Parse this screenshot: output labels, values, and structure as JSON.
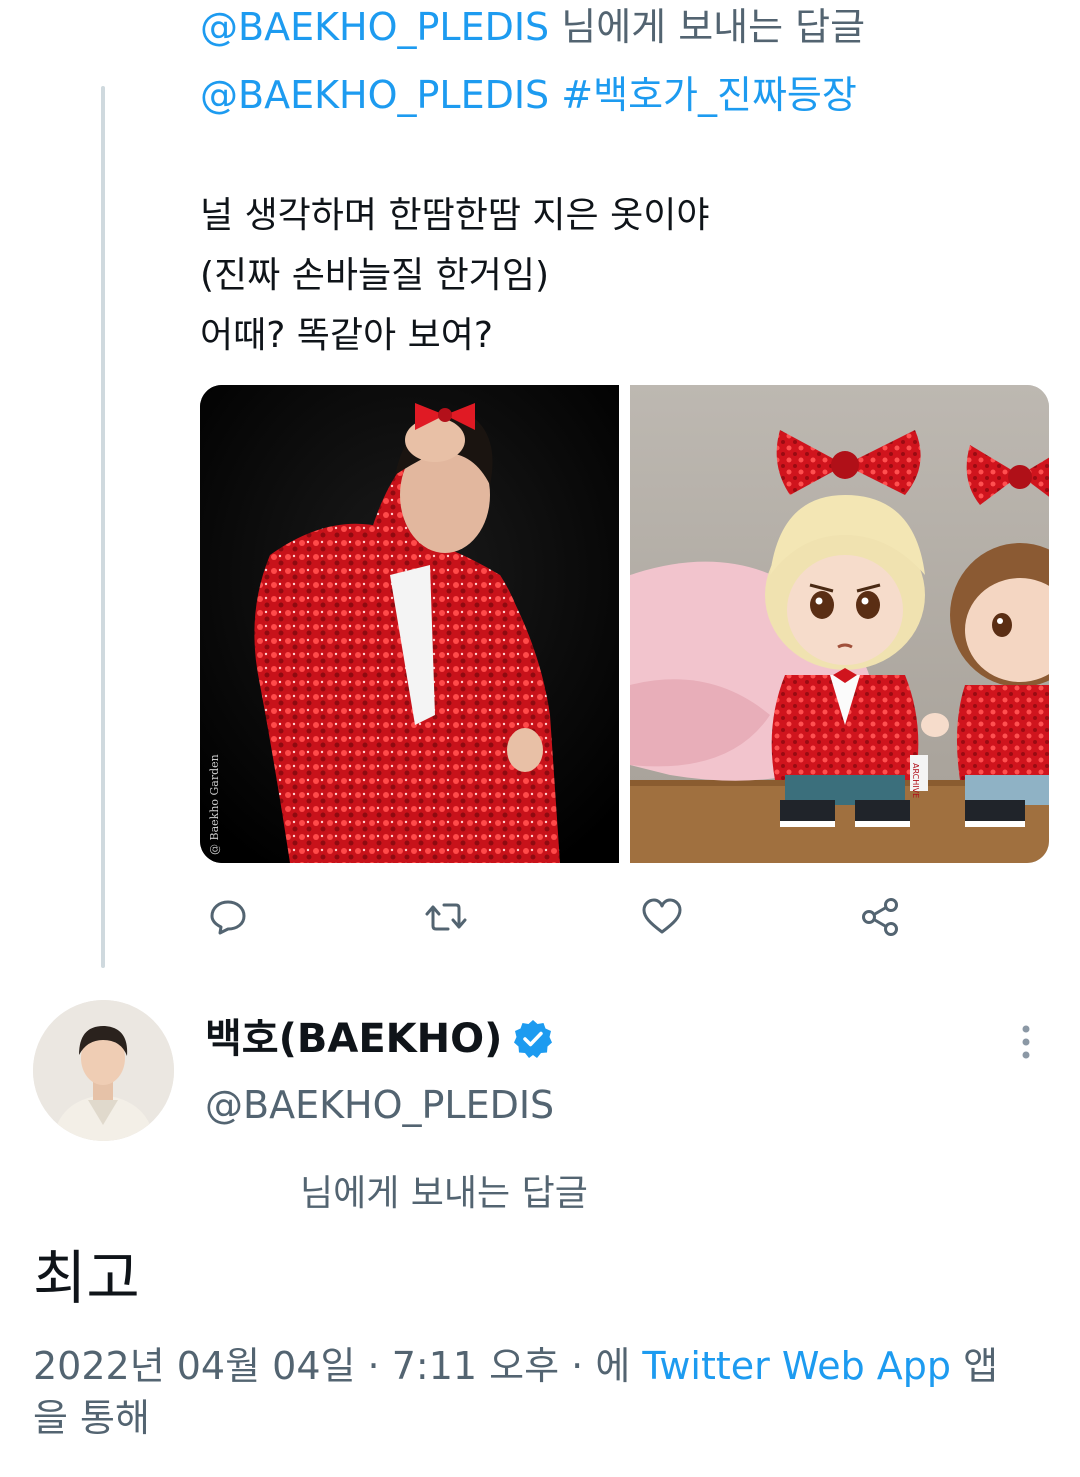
{
  "prev_tweet": {
    "reply_to_handle": "@BAEKHO_PLEDIS",
    "reply_to_suffix": "님에게 보내는 답글",
    "mention": "@BAEKHO_PLEDIS",
    "hashtag": "#백호가_진짜등장",
    "body_lines": [
      "널 생각하며 한땀한땀 지은 옷이야",
      "(진짜 손바늘질 한거임)",
      "어때? 똑같아 보여?"
    ],
    "photos": [
      {
        "icon": "photo-performer-red-sequin-jacket",
        "watermark": "@ Baekho Garden"
      },
      {
        "icon": "photo-plush-dolls-red-bows",
        "doll_tag": "ARCHIVE"
      }
    ],
    "actions": [
      {
        "icon": "reply-icon"
      },
      {
        "icon": "retweet-icon"
      },
      {
        "icon": "like-icon"
      },
      {
        "icon": "share-icon"
      }
    ]
  },
  "main_tweet": {
    "author_name": "백호(BAEKHO)",
    "verified_icon": "verified-badge-icon",
    "author_handle": "@BAEKHO_PLEDIS",
    "reply_suffix": "님에게 보내는 답글",
    "text": "최고",
    "date": "2022년 04월 04일",
    "separator": "·",
    "time": "7:11 오후",
    "via_prefix": "에",
    "client": "Twitter Web App",
    "via_suffix": "앱을 통해"
  },
  "colors": {
    "link": "#1d9bf0",
    "secondary_text": "#536471",
    "primary_text": "#0f1419",
    "thread_line": "#cfd9de"
  }
}
